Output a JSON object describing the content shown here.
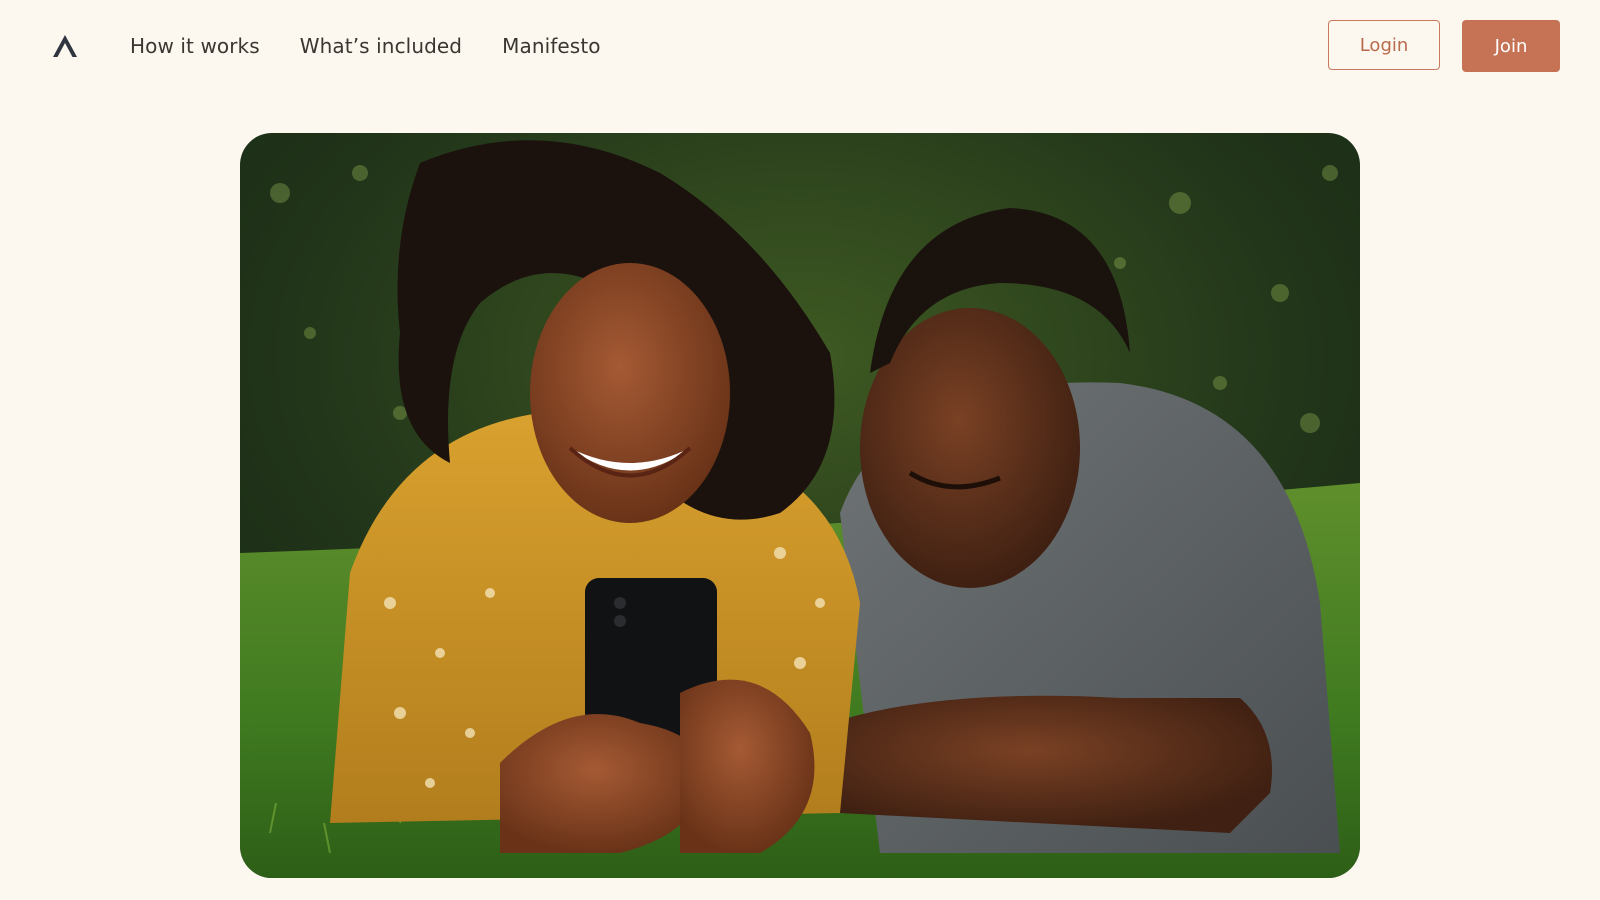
{
  "nav": {
    "logo_icon": "triangle-logo-icon",
    "links": [
      {
        "label": "How it works"
      },
      {
        "label": "What’s included"
      },
      {
        "label": "Manifesto"
      }
    ],
    "login_label": "Login",
    "join_label": "Join"
  },
  "hero": {
    "image_alt": "Two people lying on grass smiling at a phone"
  },
  "colors": {
    "background": "#fcf8f0",
    "accent": "#c57354",
    "text": "#3a3632"
  }
}
